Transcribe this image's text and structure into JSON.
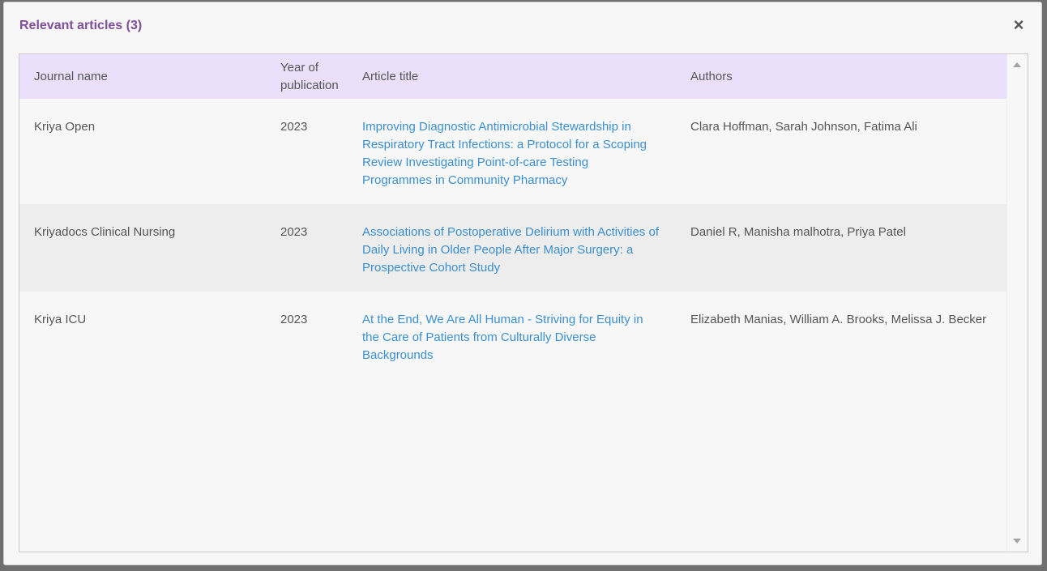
{
  "modal": {
    "title": "Relevant articles (3)",
    "close_icon": "close-icon",
    "close_glyph": "×"
  },
  "table": {
    "headers": {
      "journal": "Journal name",
      "year_line1": "Year of",
      "year_line2": "publication",
      "title": "Article title",
      "authors": "Authors"
    },
    "rows": [
      {
        "journal": "Kriya Open",
        "year": "2023",
        "title": "Improving Diagnostic Antimicrobial Stewardship in Respiratory Tract Infections: a Protocol for a Scoping Review Investigating Point-of-care Testing Programmes in Community Pharmacy",
        "authors": "Clara Hoffman, Sarah Johnson, Fatima Ali"
      },
      {
        "journal": "Kriyadocs Clinical Nursing",
        "year": "2023",
        "title": "Associations of Postoperative Delirium with Activities of Daily Living in Older People After Major Surgery: a Prospective Cohort Study",
        "authors": "Daniel R, Manisha malhotra, Priya Patel"
      },
      {
        "journal": "Kriya ICU",
        "year": "2023",
        "title": "At the End, We Are All Human - Striving for Equity in the Care of Patients from Culturally Diverse Backgrounds",
        "authors": "Elizabeth Manias, William A. Brooks, Melissa J. Becker"
      }
    ]
  },
  "colors": {
    "title": "#7e4e9a",
    "header_bg": "#eae0fc",
    "link": "#3a8fd0"
  }
}
